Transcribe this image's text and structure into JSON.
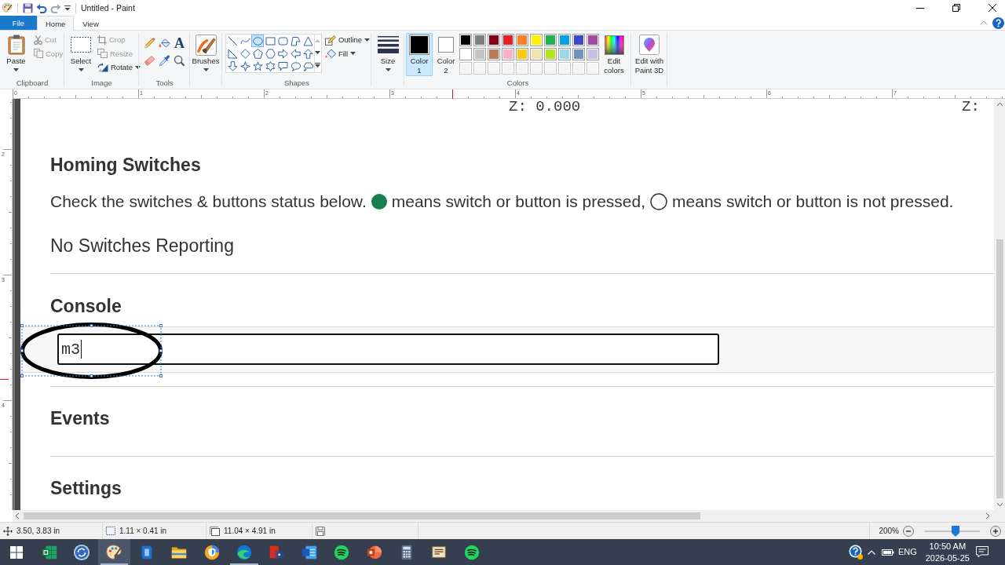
{
  "window": {
    "title": "Untitled - Paint"
  },
  "ribbon": {
    "file_menu": {
      "label": "File"
    },
    "tabs": [
      {
        "label": "Home",
        "selected": true
      },
      {
        "label": "View",
        "selected": false
      }
    ],
    "clipboard": {
      "label": "Clipboard",
      "paste": {
        "label": "Paste"
      },
      "actions": [
        {
          "kind": "cut",
          "label": "Cut",
          "disabled": true,
          "dropdown": false
        },
        {
          "kind": "copy",
          "label": "Copy",
          "disabled": true,
          "dropdown": false
        }
      ]
    },
    "image": {
      "label": "Image",
      "select": {
        "label": "Select"
      },
      "actions": [
        {
          "kind": "crop",
          "label": "Crop",
          "disabled": true,
          "dropdown": false
        },
        {
          "kind": "resize",
          "label": "Resize",
          "disabled": true,
          "dropdown": false
        },
        {
          "kind": "rotate",
          "label": "Rotate",
          "disabled": false,
          "dropdown": true
        }
      ]
    },
    "tools": {
      "label": "Tools",
      "items": [
        {
          "kind": "pencil",
          "selected": false
        },
        {
          "kind": "fill",
          "selected": false
        },
        {
          "kind": "text",
          "glyph": "A",
          "selected": false
        },
        {
          "kind": "eraser",
          "selected": false
        },
        {
          "kind": "picker",
          "selected": false
        },
        {
          "kind": "magnifier",
          "selected": false
        }
      ]
    },
    "brushes": {
      "label": "Brushes"
    },
    "shapes": {
      "label": "Shapes",
      "gallery": [
        {
          "kind": "line",
          "selected": false
        },
        {
          "kind": "curve",
          "selected": false
        },
        {
          "kind": "oval",
          "selected": true
        },
        {
          "kind": "rectangle",
          "selected": false
        },
        {
          "kind": "roundrect",
          "selected": false
        },
        {
          "kind": "polygon",
          "selected": false
        },
        {
          "kind": "triangle",
          "selected": false
        },
        {
          "kind": "righttriangle",
          "selected": false
        },
        {
          "kind": "diamond",
          "selected": false
        },
        {
          "kind": "pentagon",
          "selected": false
        },
        {
          "kind": "hexagon",
          "selected": false
        },
        {
          "kind": "arrowright",
          "selected": false
        },
        {
          "kind": "arrowleft",
          "selected": false
        },
        {
          "kind": "arrowup",
          "selected": false
        },
        {
          "kind": "arrowdown",
          "selected": false
        },
        {
          "kind": "star4",
          "selected": false
        },
        {
          "kind": "star5",
          "selected": false
        },
        {
          "kind": "star6",
          "selected": false
        },
        {
          "kind": "callout",
          "selected": false
        },
        {
          "kind": "ovalcallout",
          "selected": false
        },
        {
          "kind": "cloudcallout",
          "selected": false
        }
      ],
      "actions": [
        {
          "kind": "outline",
          "label": "Outline",
          "disabled": false,
          "dropdown": true
        },
        {
          "kind": "fill",
          "label": "Fill",
          "disabled": false,
          "dropdown": true
        }
      ]
    },
    "size": {
      "label": "Size"
    },
    "colors": {
      "label": "Colors",
      "slots": [
        {
          "label": "Color 1",
          "color": "#000000",
          "selected": true
        },
        {
          "label": "Color 2",
          "color": "#ffffff",
          "selected": false
        }
      ],
      "palette": [
        {
          "kind": "color",
          "color": "#000000"
        },
        {
          "kind": "color",
          "color": "#7f7f7f"
        },
        {
          "kind": "color",
          "color": "#880015"
        },
        {
          "kind": "color",
          "color": "#ed1c24"
        },
        {
          "kind": "color",
          "color": "#ff7f27"
        },
        {
          "kind": "color",
          "color": "#fff200"
        },
        {
          "kind": "color",
          "color": "#22b14c"
        },
        {
          "kind": "color",
          "color": "#00a2e8"
        },
        {
          "kind": "color",
          "color": "#3f48cc"
        },
        {
          "kind": "color",
          "color": "#a349a4"
        },
        {
          "kind": "color",
          "color": "#ffffff"
        },
        {
          "kind": "color",
          "color": "#c3c3c3"
        },
        {
          "kind": "color",
          "color": "#b97a57"
        },
        {
          "kind": "color",
          "color": "#ffaec9"
        },
        {
          "kind": "color",
          "color": "#ffc90e"
        },
        {
          "kind": "color",
          "color": "#efe4b0"
        },
        {
          "kind": "color",
          "color": "#b5e61d"
        },
        {
          "kind": "color",
          "color": "#99d9ea"
        },
        {
          "kind": "color",
          "color": "#7092be"
        },
        {
          "kind": "color",
          "color": "#c8bfe7"
        },
        {
          "kind": "empty"
        },
        {
          "kind": "empty"
        },
        {
          "kind": "empty"
        },
        {
          "kind": "empty"
        },
        {
          "kind": "empty"
        },
        {
          "kind": "empty"
        },
        {
          "kind": "empty"
        },
        {
          "kind": "empty"
        },
        {
          "kind": "empty"
        },
        {
          "kind": "empty"
        }
      ],
      "edit": {
        "label": "Edit colors"
      }
    },
    "paint3d": {
      "label": "Edit with Paint 3D"
    }
  },
  "rulers": {
    "horizontal": [
      "0",
      "1",
      "2",
      "3",
      "4",
      "5",
      "6",
      "7"
    ],
    "vertical": [
      "2",
      "3",
      "4"
    ]
  },
  "canvas": {
    "coordinates": [
      "Z: 0.000",
      "Z:"
    ],
    "homing": {
      "title": "Homing Switches",
      "intro": "Check the switches & buttons status below.",
      "legend": [
        {
          "pressed": true,
          "text": "means switch or button is pressed,"
        },
        {
          "pressed": false,
          "text": "means switch or button is not pressed."
        }
      ],
      "status": "No Switches Reporting"
    },
    "console": {
      "title": "Console",
      "input": {
        "value": "m3"
      }
    },
    "sections": [
      {
        "title": "Events"
      },
      {
        "title": "Settings"
      }
    ]
  },
  "status_bar": {
    "cursor": "3.50, 3.83 in",
    "selection": "1.11 × 0.41 in",
    "canvas_size": "11.04 × 4.91 in",
    "zoom": {
      "label": "200%",
      "level": 0.56
    }
  },
  "taskbar": {
    "apps": [
      {
        "kind": "spreadsheet",
        "active": false,
        "running": false
      },
      {
        "kind": "sync",
        "active": false,
        "running": false
      },
      {
        "kind": "paint",
        "active": true,
        "running": true
      },
      {
        "kind": "tile",
        "active": false,
        "running": false
      },
      {
        "kind": "folder",
        "active": false,
        "running": false
      },
      {
        "kind": "shieldbrowser",
        "active": false,
        "running": false
      },
      {
        "kind": "swirlbrowser",
        "active": false,
        "running": true
      },
      {
        "kind": "gearapp",
        "active": false,
        "running": false
      },
      {
        "kind": "document",
        "active": false,
        "running": false
      },
      {
        "kind": "music",
        "active": false,
        "running": false
      },
      {
        "kind": "presentation",
        "active": false,
        "running": false
      },
      {
        "kind": "calculator",
        "active": false,
        "running": false
      },
      {
        "kind": "notes",
        "active": false,
        "running": false
      },
      {
        "kind": "music",
        "active": false,
        "running": false
      }
    ],
    "tray": {
      "language": "ENG",
      "time": "10:50 AM",
      "date": "2026-05-25"
    }
  }
}
